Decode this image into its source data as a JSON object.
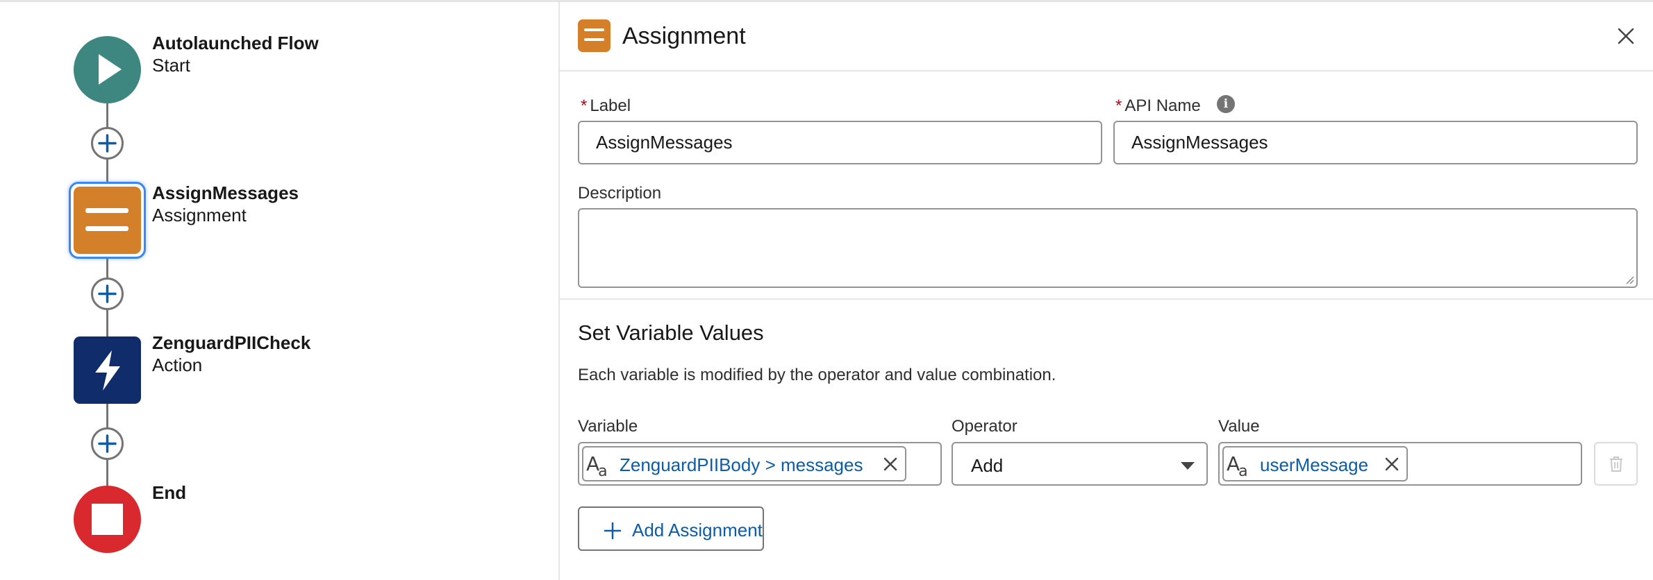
{
  "canvas": {
    "nodes": [
      {
        "title": "Autolaunched Flow",
        "subtitle": "Start",
        "icon": "play-icon",
        "color": "#3e8781"
      },
      {
        "title": "AssignMessages",
        "subtitle": "Assignment",
        "icon": "assignment-icon",
        "color": "#d4802b",
        "selected": true
      },
      {
        "title": "ZenguardPIICheck",
        "subtitle": "Action",
        "icon": "lightning-icon",
        "color": "#112c6a"
      },
      {
        "title": "End",
        "subtitle": "",
        "icon": "stop-icon",
        "color": "#d9282e"
      }
    ],
    "add_element_icon": "plus-circle-icon"
  },
  "panel": {
    "title": "Assignment",
    "label_field": {
      "label": "Label",
      "required_marker": "*",
      "value": "AssignMessages"
    },
    "api_name_field": {
      "label": "API Name",
      "required_marker": "*",
      "value": "AssignMessages",
      "info_glyph": "i"
    },
    "description_field": {
      "label": "Description",
      "value": ""
    },
    "section": {
      "title": "Set Variable Values",
      "description": "Each variable is modified by the operator and value combination."
    },
    "columns": {
      "variable": "Variable",
      "operator": "Operator",
      "value": "Value"
    },
    "row": {
      "variable": "ZenguardPIIBody > messages",
      "operator": "Add",
      "value": "userMessage",
      "type_icon_text": "A",
      "type_icon_sub": "a"
    },
    "add_assignment_label": "Add Assignment"
  }
}
